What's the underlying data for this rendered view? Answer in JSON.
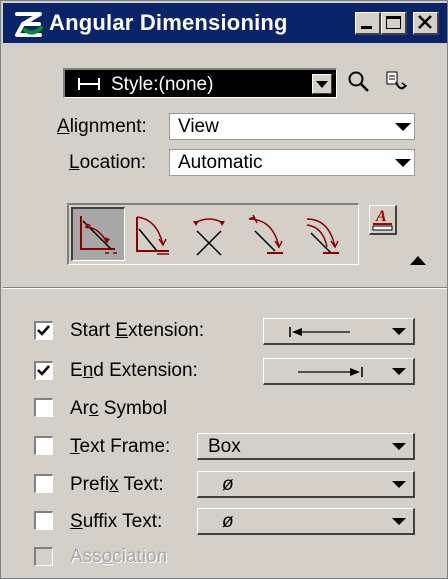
{
  "window": {
    "title": "Angular Dimensioning",
    "icon": "microstation-logo-icon",
    "controls": [
      "minimize-icon",
      "maximize-icon",
      "close-icon"
    ]
  },
  "style_bar": {
    "style_value": "Style:(none)",
    "icons": [
      "dimension-style-icon",
      "magnifier-icon",
      "style-options-icon"
    ]
  },
  "alignment": {
    "label_pre": "",
    "label_key": "A",
    "label_post": "lignment:",
    "value": "View"
  },
  "location": {
    "label_pre": "",
    "label_key": "L",
    "label_post": "ocation:",
    "value": "Automatic"
  },
  "tools": {
    "selected_index": 0,
    "items": [
      "dimension-size-angle-icon",
      "dimension-angle-location-icon",
      "dimension-angle-lines-icon",
      "dimension-angle-x-axis-icon",
      "dimension-angle-y-axis-icon"
    ],
    "extra_icon": "text-settings-icon",
    "expand_icon": "collapse-arrow-icon"
  },
  "options": {
    "start_extension": {
      "pre": "Start ",
      "key": "E",
      "post": "xtension:",
      "checked": true,
      "value_icon": "terminator-arrow-left-icon"
    },
    "end_extension": {
      "pre": "E",
      "key": "n",
      "post": "d Extension:",
      "checked": true,
      "value_icon": "terminator-arrow-right-icon"
    },
    "arc_symbol": {
      "pre": "Ar",
      "key": "c",
      "post": " Symbol",
      "checked": false
    },
    "text_frame": {
      "pre": "",
      "key": "T",
      "post": "ext Frame:",
      "checked": false,
      "value": "Box"
    },
    "prefix_text": {
      "pre": "Prefi",
      "key": "x",
      "post": " Text:",
      "checked": false,
      "value": "ø"
    },
    "suffix_text": {
      "pre": "",
      "key": "S",
      "post": "uffix Text:",
      "checked": false,
      "value": "ø"
    },
    "association": {
      "pre": "Ass",
      "key": "o",
      "post": "ciation",
      "checked": false,
      "disabled": true
    }
  },
  "colors": {
    "titlebar": "#0a246a",
    "face": "#d4d0c8",
    "selected_tool": "#a7a7a7"
  }
}
